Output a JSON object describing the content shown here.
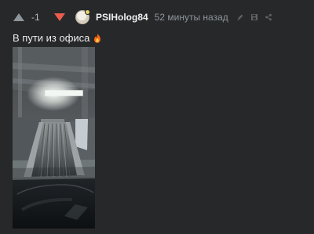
{
  "post": {
    "rating": "-1",
    "author": "PSIHolog84",
    "timestamp": "52 минуты назад",
    "text": "В пути из офиса"
  },
  "colors": {
    "upvote": "#8f959d",
    "downvote": "#eb5c4f",
    "background": "#26282a",
    "meta": "#8f959d",
    "author": "#f0f0f0"
  },
  "icons": {
    "upvote": "triangle-up-icon",
    "downvote": "triangle-down-icon",
    "edit": "pencil-icon",
    "save": "floppy-disk-icon",
    "share": "share-icon",
    "emoji": "fire-icon"
  }
}
